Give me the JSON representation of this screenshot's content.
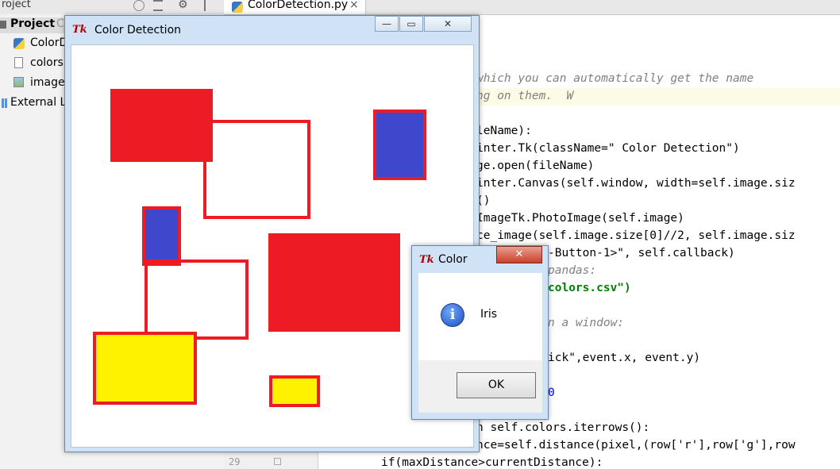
{
  "ide": {
    "top_left_label": "roject",
    "editor_tab": "ColorDetection.py",
    "editor_tab_close": "×",
    "project_header": "Project",
    "project_header_suffix": "C",
    "tree_items": [
      "ColorD",
      "colors.",
      "image",
      "External Li"
    ],
    "line_number": "29",
    "code_lines": [
      {
        "text": "which you can automatically get the name",
        "cls": "cmt"
      },
      {
        "text": "ng on them.  W",
        "cls": "cmt"
      },
      {
        "text": "leName):",
        "cls": ""
      },
      {
        "text": "inter.Tk(className=\" Color Detection\")",
        "cls": ""
      },
      {
        "text": "ge.open(fileName)",
        "cls": ""
      },
      {
        "text": "inter.Canvas(self.window, width=self.image.siz",
        "cls": ""
      },
      {
        "text": "()",
        "cls": ""
      },
      {
        "text": "ImageTk.PhotoImage(self.image)",
        "cls": ""
      },
      {
        "text": "ce_image(self.image.size[0]//2, self.image.siz",
        "cls": ""
      },
      {
        "text": "-Button-1>\", self.callback)",
        "cls": ""
      },
      {
        "text": "pandas:",
        "cls": "cmt"
      },
      {
        "text": "colors.csv\")",
        "cls": ""
      },
      {
        "text": "n a window:",
        "cls": "cmt"
      },
      {
        "text": "ick\",event.x, event.y)",
        "cls": ""
      },
      {
        "text": "0",
        "cls": ""
      },
      {
        "text": "n self.colors.iterrows():",
        "cls": ""
      },
      {
        "text": "nce=self.distance(pixel,(row['r'],row['g'],row",
        "cls": ""
      },
      {
        "text": "if(maxDistance>currentDistance):",
        "cls": ""
      }
    ]
  },
  "main_window": {
    "icon_text": "Tk",
    "title": "Color Detection",
    "minimize": "—",
    "maximize": "▭",
    "close": "✕"
  },
  "canvas_shapes": {
    "colors": {
      "red": "#ed1c24",
      "blue": "#3f48cc",
      "yellow": "#fff200",
      "white": "#ffffff"
    }
  },
  "dialog": {
    "icon_text": "Tk",
    "title": "Color",
    "close": "✕",
    "info_icon": "i",
    "message": "Iris",
    "ok_button": "OK"
  }
}
